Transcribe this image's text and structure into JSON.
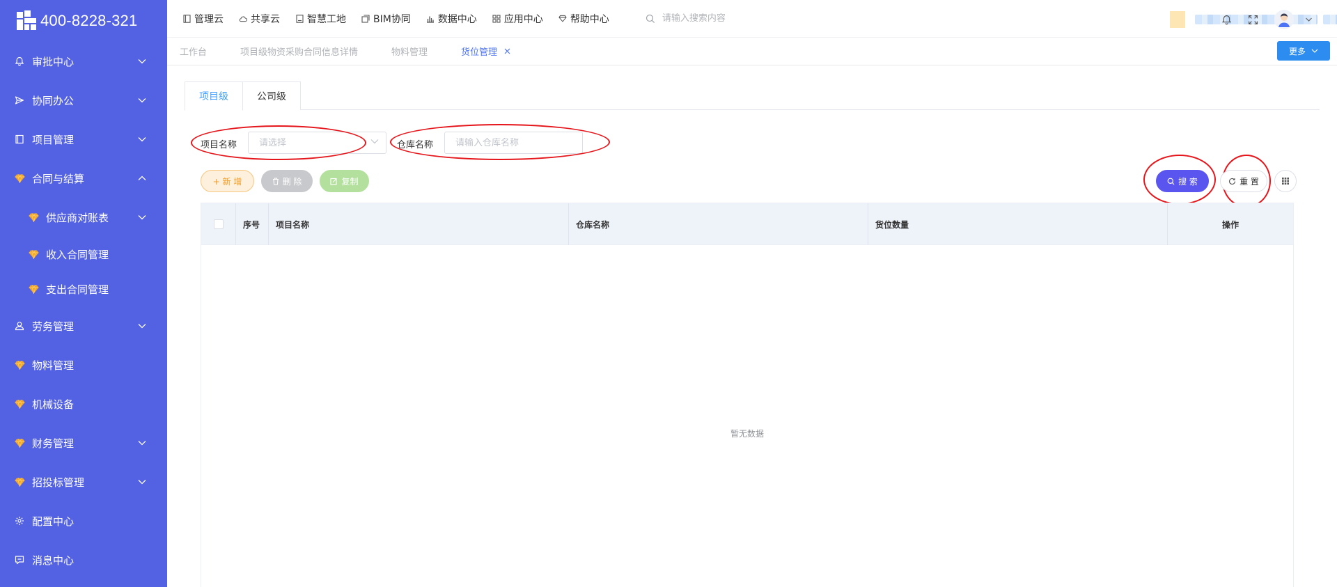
{
  "brand": {
    "phone": "400-8228-321"
  },
  "sidebar": {
    "items": [
      {
        "label": "审批中心",
        "icon": "bell-icon",
        "expandable": true,
        "expanded": false
      },
      {
        "label": "协同办公",
        "icon": "send-icon",
        "expandable": true,
        "expanded": false
      },
      {
        "label": "项目管理",
        "icon": "book-icon",
        "expandable": true,
        "expanded": false
      },
      {
        "label": "合同与结算",
        "icon": "gem-icon",
        "expandable": true,
        "expanded": true
      },
      {
        "label": "供应商对账表",
        "icon": "gem-icon",
        "expandable": true,
        "expanded": false,
        "sub": true
      },
      {
        "label": "收入合同管理",
        "icon": "gem-icon",
        "expandable": false,
        "sub": true
      },
      {
        "label": "支出合同管理",
        "icon": "gem-icon",
        "expandable": false,
        "sub": true
      },
      {
        "label": "劳务管理",
        "icon": "worker-icon",
        "expandable": true,
        "expanded": false
      },
      {
        "label": "物料管理",
        "icon": "gem-icon",
        "expandable": false
      },
      {
        "label": "机械设备",
        "icon": "gem-icon",
        "expandable": false
      },
      {
        "label": "财务管理",
        "icon": "gem-icon",
        "expandable": true,
        "expanded": false
      },
      {
        "label": "招投标管理",
        "icon": "gem-icon",
        "expandable": true,
        "expanded": false
      },
      {
        "label": "配置中心",
        "icon": "gear-icon",
        "expandable": false
      },
      {
        "label": "消息中心",
        "icon": "message-icon",
        "expandable": false
      }
    ]
  },
  "topnav": {
    "items": [
      {
        "label": "管理云",
        "icon": "document-icon"
      },
      {
        "label": "共享云",
        "icon": "cloud-icon"
      },
      {
        "label": "智慧工地",
        "icon": "book-icon"
      },
      {
        "label": "BIM协同",
        "icon": "cube-icon"
      },
      {
        "label": "数据中心",
        "icon": "bar-chart-icon"
      },
      {
        "label": "应用中心",
        "icon": "apps-icon"
      },
      {
        "label": "帮助中心",
        "icon": "diamond-icon"
      }
    ],
    "search_placeholder": "请输入搜索内容"
  },
  "page_tabs": [
    {
      "label": "工作台",
      "active": false
    },
    {
      "label": "项目级物资采购合同信息详情",
      "active": false
    },
    {
      "label": "物料管理",
      "active": false
    },
    {
      "label": "货位管理",
      "active": true,
      "closable": true
    }
  ],
  "more_label": "更多",
  "subtabs": [
    {
      "label": "项目级",
      "active": true
    },
    {
      "label": "公司级",
      "active": false
    }
  ],
  "filters": {
    "project_label": "项目名称",
    "project_placeholder": "请选择",
    "warehouse_label": "仓库名称",
    "warehouse_placeholder": "请输入仓库名称"
  },
  "actions": {
    "add": "+ 新 增",
    "delete": "删 除",
    "copy": "复制",
    "search": "搜 索",
    "reset": "重 置"
  },
  "table": {
    "columns": [
      "序号",
      "项目名称",
      "仓库名称",
      "货位数量",
      "操作"
    ],
    "empty_text": "暂无数据"
  },
  "colors": {
    "sidebar_bg": "#5361e3",
    "primary": "#2d8cf0",
    "search_btn": "#5a55ee",
    "annotation": "#e5161b"
  }
}
